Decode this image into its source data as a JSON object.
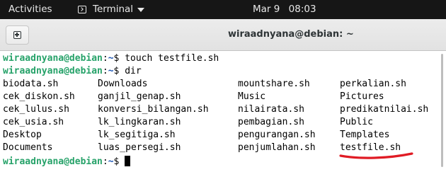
{
  "topbar": {
    "activities": "Activities",
    "app_name": "Terminal",
    "date": "Mar 9",
    "time": "08:03"
  },
  "window": {
    "title": "wiraadnyana@debian: ~"
  },
  "terminal": {
    "prompt_user": "wiraadnyana@debian",
    "prompt_sep": ":",
    "prompt_path": "~",
    "prompt_symbol": "$",
    "commands": [
      " touch testfile.sh",
      " dir",
      " "
    ],
    "dir_columns": [
      [
        "biodata.sh",
        "cek_diskon.sh",
        "cek_lulus.sh",
        "cek_usia.sh",
        "Desktop",
        "Documents"
      ],
      [
        "Downloads",
        "ganjil_genap.sh",
        "konversi_bilangan.sh",
        "lk_lingkaran.sh",
        "lk_segitiga.sh",
        "luas_persegi.sh"
      ],
      [
        "mountshare.sh",
        "Music",
        "nilairata.sh",
        "pembagian.sh",
        "pengurangan.sh",
        "penjumlahan.sh"
      ],
      [
        "perkalian.sh",
        "Pictures",
        "predikatnilai.sh",
        "Public",
        "Templates",
        "testfile.sh"
      ]
    ]
  },
  "colors": {
    "prompt_user": "#26a269",
    "prompt_path": "#1e57b5",
    "annotation": "#e01b24",
    "topbar_bg": "#161616"
  },
  "icons": {
    "app": "terminal-icon",
    "dropdown": "chevron-down-icon",
    "new_tab": "new-tab-icon"
  }
}
